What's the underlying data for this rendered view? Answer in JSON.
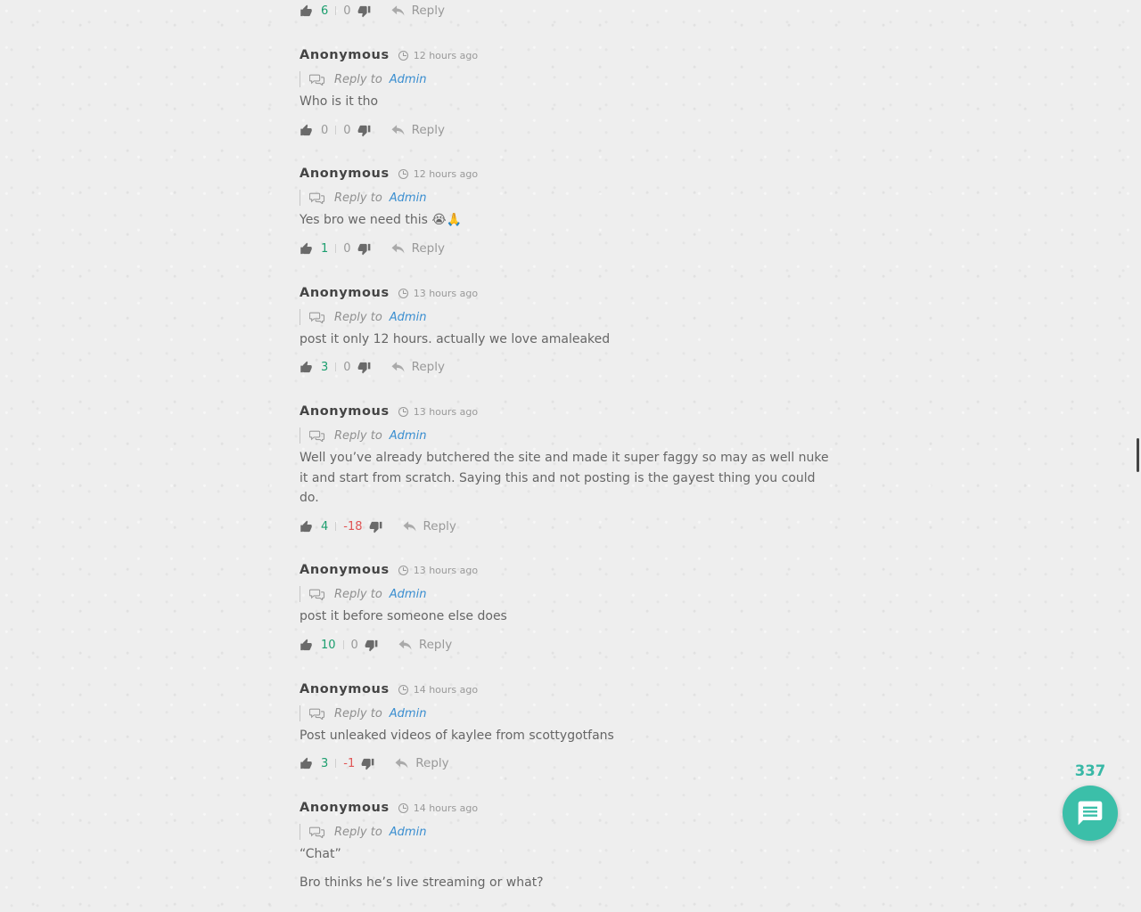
{
  "top_bar": {
    "likes": "6",
    "dislikes": "0",
    "reply_label": "Reply"
  },
  "comments": [
    {
      "author": "Anonymous",
      "time": "12 hours ago",
      "reply_to_label": "Reply to",
      "reply_to": "Admin",
      "text": "Who is it tho",
      "likes": "0",
      "dislikes": "0",
      "reply_label": "Reply"
    },
    {
      "author": "Anonymous",
      "time": "12 hours ago",
      "reply_to_label": "Reply to",
      "reply_to": "Admin",
      "text": "Yes bro we need this 😭🙏",
      "likes": "1",
      "dislikes": "0",
      "reply_label": "Reply"
    },
    {
      "author": "Anonymous",
      "time": "13 hours ago",
      "reply_to_label": "Reply to",
      "reply_to": "Admin",
      "text": "post it only 12 hours. actually we love amaleaked",
      "likes": "3",
      "dislikes": "0",
      "reply_label": "Reply"
    },
    {
      "author": "Anonymous",
      "time": "13 hours ago",
      "reply_to_label": "Reply to",
      "reply_to": "Admin",
      "text": "Well you’ve already butchered the site and made it super faggy so may as well nuke it and start from scratch. Saying this and not posting is the gayest thing you could do.",
      "likes": "4",
      "dislikes": "-18",
      "reply_label": "Reply"
    },
    {
      "author": "Anonymous",
      "time": "13 hours ago",
      "reply_to_label": "Reply to",
      "reply_to": "Admin",
      "text": "post it before someone else does",
      "likes": "10",
      "dislikes": "0",
      "reply_label": "Reply"
    },
    {
      "author": "Anonymous",
      "time": "14 hours ago",
      "reply_to_label": "Reply to",
      "reply_to": "Admin",
      "text": "Post unleaked videos of kaylee from scottygotfans",
      "likes": "3",
      "dislikes": "-1",
      "reply_label": "Reply"
    },
    {
      "author": "Anonymous",
      "time": "14 hours ago",
      "reply_to_label": "Reply to",
      "reply_to": "Admin",
      "text": "“Chat”",
      "text_extra": "Bro thinks he’s live streaming or what?"
    }
  ],
  "chat_widget": {
    "count": "337",
    "icon": "chat-bubble-icon",
    "color": "#3bbfa9"
  },
  "colors": {
    "positive": "#1b9e6e",
    "negative": "#e05454",
    "link": "#3a8ed0"
  }
}
